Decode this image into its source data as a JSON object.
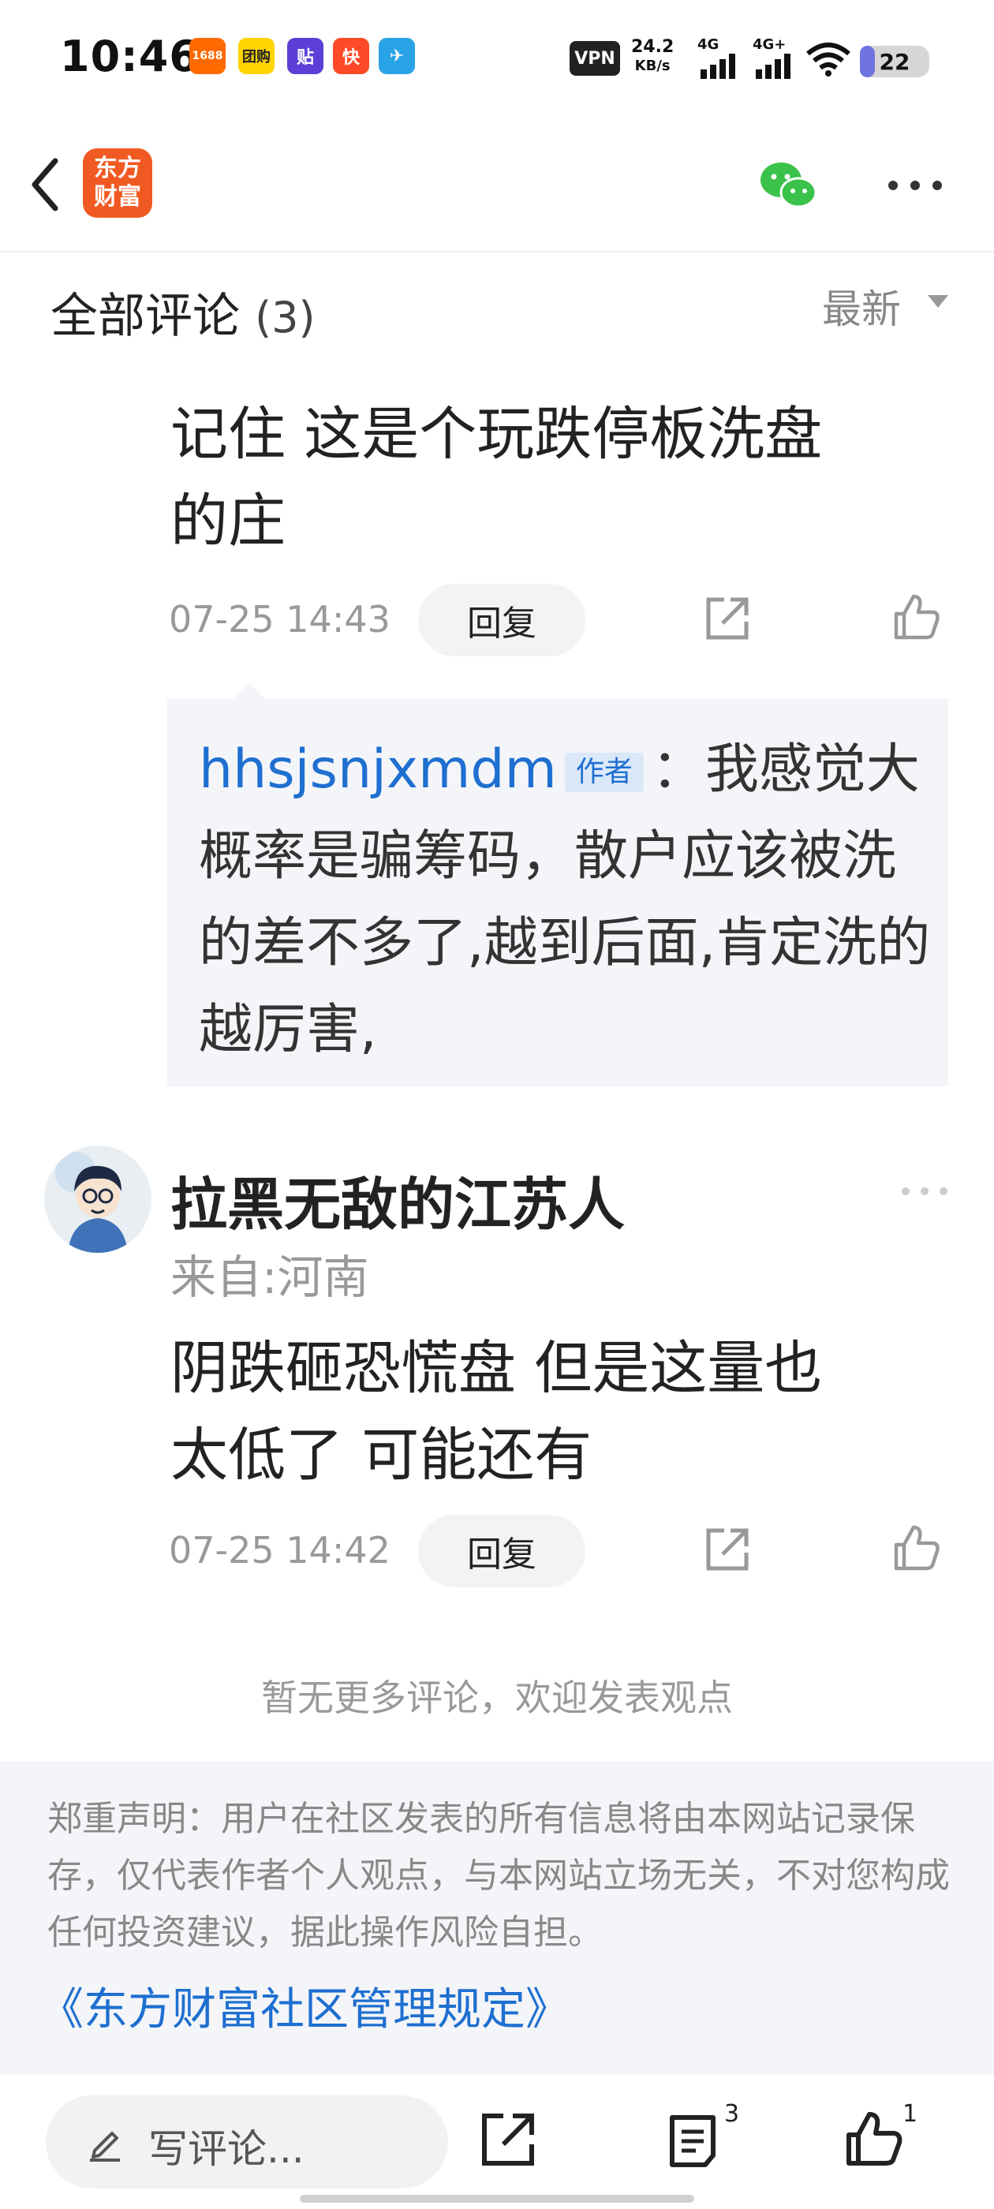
{
  "status_bar": {
    "time": "10:46",
    "app_icons": [
      "1688",
      "团购",
      "贴",
      "快",
      "✈"
    ],
    "vpn_label": "VPN",
    "net_speed_value": "24.2",
    "net_speed_unit": "KB/s",
    "signal1_label": "4G",
    "signal2_label": "4G+",
    "battery_level": "22"
  },
  "nav": {
    "logo_line1": "东方",
    "logo_line2": "财富"
  },
  "comments": {
    "title": "全部评论",
    "count": "(3)",
    "sort_label": "最新",
    "items": [
      {
        "text_line1": "记住 这是个玩跌停板洗盘",
        "text_line2": "的庄",
        "time": "07-25 14:43",
        "reply_label": "回复",
        "quoted_reply": {
          "user": "hhsjsnjxmdm",
          "badge": "作者",
          "text": "：我感觉大概率是骗筹码，散户应该被洗的差不多了,越到后面,肯定洗的越厉害,"
        }
      },
      {
        "username": "拉黑无敌的江苏人",
        "location": "来自:河南",
        "text_line1": "阴跌砸恐慌盘 但是这量也",
        "text_line2": "太低了 可能还有",
        "time": "07-25 14:42",
        "reply_label": "回复"
      }
    ],
    "no_more_text": "暂无更多评论，欢迎发表观点"
  },
  "disclaimer": {
    "text": "郑重声明：用户在社区发表的所有信息将由本网站记录保存，仅代表作者个人观点，与本网站立场无关，不对您构成任何投资建议，据此操作风险自担。",
    "rules_link": "《东方财富社区管理规定》"
  },
  "bottom_bar": {
    "compose_placeholder": "写评论...",
    "comment_count": "3",
    "like_count": "1"
  },
  "colors": {
    "brand_orange": "#f05a22",
    "link_blue": "#1e6fd0",
    "quote_bg": "#f4f5f8",
    "wechat_green": "#3bc24a"
  }
}
